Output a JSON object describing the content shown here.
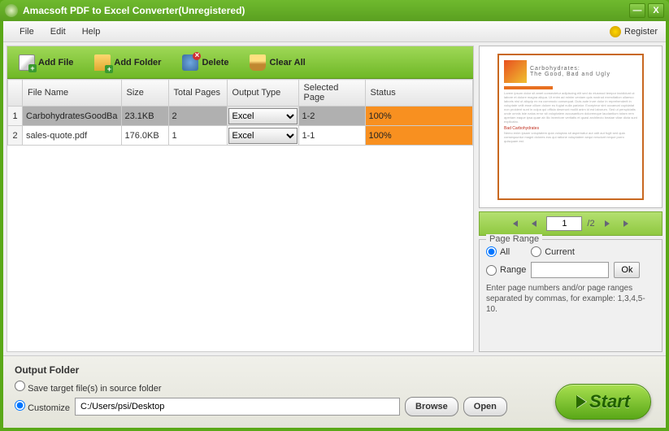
{
  "window": {
    "title": "Amacsoft PDF to Excel Converter(Unregistered)"
  },
  "menu": {
    "file": "File",
    "edit": "Edit",
    "help": "Help",
    "register": "Register"
  },
  "toolbar": {
    "add_file": "Add File",
    "add_folder": "Add Folder",
    "delete": "Delete",
    "clear_all": "Clear All"
  },
  "table": {
    "headers": {
      "filename": "File Name",
      "size": "Size",
      "total_pages": "Total Pages",
      "output_type": "Output Type",
      "selected_page": "Selected Page",
      "status": "Status"
    },
    "rows": [
      {
        "idx": "1",
        "filename": "CarbohydratesGoodBa",
        "size": "23.1KB",
        "total_pages": "2",
        "output_type": "Excel",
        "selected_page": "1-2",
        "status": "100%"
      },
      {
        "idx": "2",
        "filename": "sales-quote.pdf",
        "size": "176.0KB",
        "total_pages": "1",
        "output_type": "Excel",
        "selected_page": "1-1",
        "status": "100%"
      }
    ]
  },
  "preview": {
    "title_line1": "Carbohydrates:",
    "title_line2": "The Good, Bad and Ugly"
  },
  "pager": {
    "current": "1",
    "total": "/2"
  },
  "pagerange": {
    "legend": "Page Range",
    "all": "All",
    "current": "Current",
    "range": "Range",
    "ok": "Ok",
    "help": "Enter page numbers and/or page ranges separated by commas, for example: 1,3,4,5-10."
  },
  "output": {
    "title": "Output Folder",
    "save_source": "Save target file(s) in source folder",
    "customize": "Customize",
    "path": "C:/Users/psi/Desktop",
    "browse": "Browse",
    "open": "Open"
  },
  "start": "Start"
}
